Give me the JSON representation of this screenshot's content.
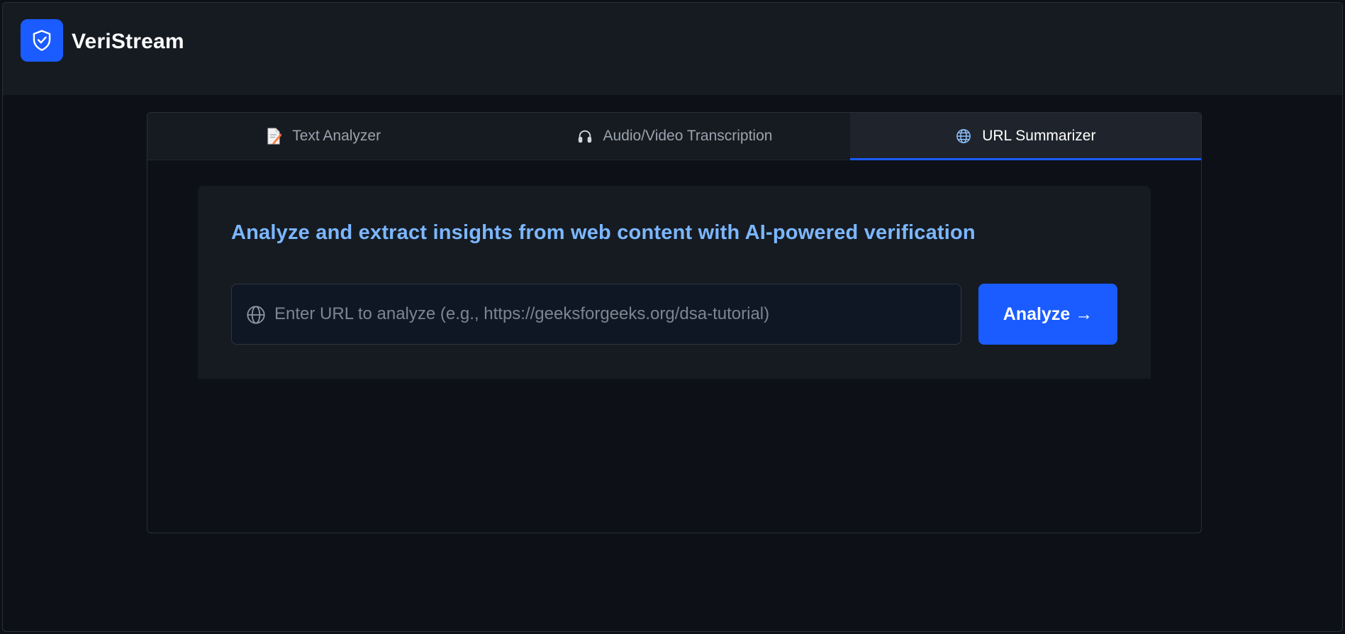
{
  "header": {
    "brand": "VeriStream",
    "logo_icon": "shield-check-icon"
  },
  "tabs": [
    {
      "label": "Text Analyzer",
      "icon": "memo-icon",
      "active": false
    },
    {
      "label": "Audio/Video Transcription",
      "icon": "headphones-icon",
      "active": false
    },
    {
      "label": "URL Summarizer",
      "icon": "globe-icon",
      "active": true
    }
  ],
  "url_summarizer": {
    "headline": "Analyze and extract insights from web content with AI-powered verification",
    "input_value": "",
    "input_placeholder": "Enter URL to analyze (e.g., https://geeksforgeeks.org/dsa-tutorial)",
    "analyze_label": "Analyze →"
  },
  "colors": {
    "accent": "#1a5cff",
    "headline": "#7cb7ff",
    "background": "#0d1117",
    "surface": "#161b22"
  }
}
